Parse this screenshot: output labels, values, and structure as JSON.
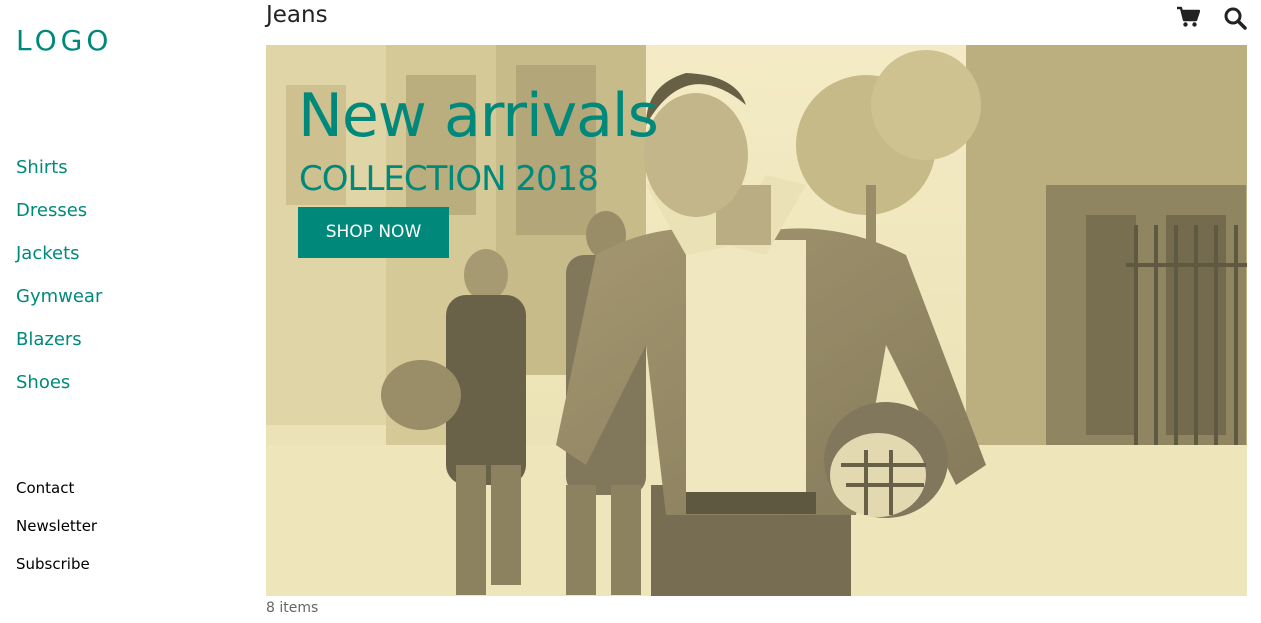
{
  "sidebar": {
    "logo": "LOGO",
    "categories": [
      {
        "label": "Shirts"
      },
      {
        "label": "Dresses"
      },
      {
        "label": "Jackets"
      },
      {
        "label": "Gymwear"
      },
      {
        "label": "Blazers"
      },
      {
        "label": "Shoes"
      }
    ],
    "footer_links": [
      {
        "label": "Contact"
      },
      {
        "label": "Newsletter"
      },
      {
        "label": "Subscribe"
      }
    ]
  },
  "header": {
    "title": "Jeans",
    "icons": [
      "cart-icon",
      "search-icon"
    ]
  },
  "hero": {
    "title": "New arrivals",
    "subtitle": "COLLECTION 2018",
    "cta_label": "SHOP NOW"
  },
  "main": {
    "item_count": "8 items"
  },
  "colors": {
    "accent": "#00897b",
    "hero_tint": "#e9e2c0"
  }
}
